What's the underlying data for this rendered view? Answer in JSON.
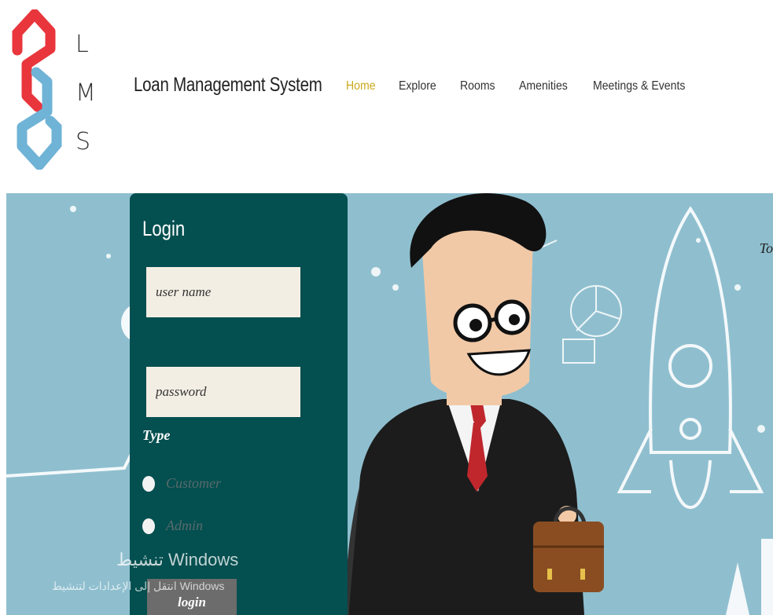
{
  "brand": {
    "letters": [
      "L",
      "M",
      "S"
    ],
    "title": "Loan Management System",
    "colors": {
      "red": "#e8363c",
      "blue": "#6fb3d6"
    }
  },
  "nav": {
    "items": [
      {
        "label": "Home",
        "active": true
      },
      {
        "label": "Explore",
        "active": false
      },
      {
        "label": "Rooms",
        "active": false
      },
      {
        "label": "Amenities",
        "active": false
      },
      {
        "label": "Meetings & Events",
        "active": false
      }
    ]
  },
  "login": {
    "title": "Login",
    "username_placeholder": "user name",
    "password_placeholder": "password",
    "type_label": "Type",
    "options": [
      "Customer",
      "Admin"
    ],
    "button_label": "login"
  },
  "hero": {
    "side_text": "To"
  },
  "watermark": {
    "line1": "تنشيط Windows",
    "line2": "انتقل إلى الإعدادات لتنشيط Windows"
  },
  "colors": {
    "accent_active_nav": "#c9a91d",
    "login_panel": "#044f50",
    "hero_bg": "#8fbfcf"
  }
}
